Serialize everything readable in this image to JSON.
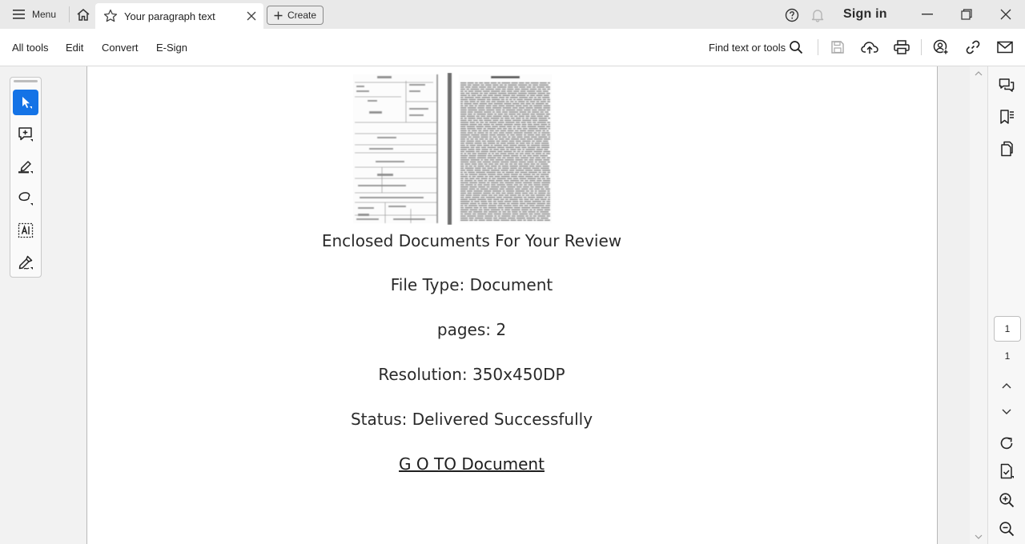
{
  "titlebar": {
    "menu_label": "Menu",
    "tab_title": "Your paragraph text",
    "create_label": "Create",
    "signin_label": "Sign in"
  },
  "toolbar": {
    "all_tools": "All tools",
    "edit": "Edit",
    "convert": "Convert",
    "esign": "E-Sign",
    "find_label": "Find text or tools"
  },
  "document": {
    "heading": "Enclosed Documents For Your Review",
    "file_type": "File Type: Document",
    "pages": "pages: 2",
    "resolution": "Resolution: 350x450DP",
    "status": "Status: Delivered Successfully",
    "link_text": "G O TO Document"
  },
  "navigation": {
    "current_page": "1",
    "total_pages": "1"
  },
  "colors": {
    "accent": "#1473e6",
    "titlebar_bg": "#e9e9e9",
    "rail_bg": "#f2f2f2"
  },
  "icons": {
    "titlebar": [
      "hamburger-icon",
      "home-icon",
      "star-icon",
      "close-tab-icon",
      "plus-icon",
      "help-icon",
      "bell-icon",
      "minimize-icon",
      "restore-icon",
      "close-window-icon"
    ],
    "toolbar": [
      "search-icon",
      "save-icon",
      "upload-cloud-icon",
      "print-icon",
      "share-user-icon",
      "link-icon",
      "mail-icon"
    ],
    "tools": [
      "select-cursor-icon",
      "add-comment-icon",
      "highlight-pen-icon",
      "draw-lasso-icon",
      "text-select-icon",
      "sign-pen-icon"
    ],
    "right_panel": [
      "comments-icon",
      "bookmarks-icon",
      "pages-icon",
      "scroll-up-icon",
      "scroll-down-icon",
      "rotate-icon",
      "page-extract-icon",
      "zoom-in-icon",
      "zoom-out-icon"
    ]
  }
}
